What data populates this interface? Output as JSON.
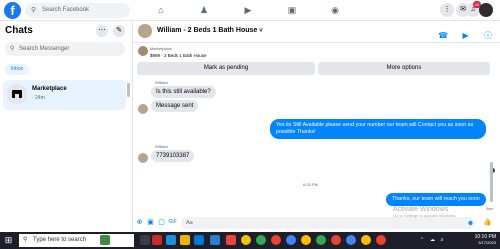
{
  "topbar": {
    "logo": "f",
    "search_placeholder": "Search Facebook",
    "notifications_badge": "20"
  },
  "sidebar": {
    "title": "Chats",
    "search_placeholder": "Search Messenger",
    "inbox_tab": "Inbox",
    "conversation": {
      "name": "Marketplace",
      "time": "· 24m"
    }
  },
  "chat": {
    "title": "William - 2 Beds 1 Bath House",
    "marketplace_label": "Marketplace",
    "listing_price_title": "$999 · 2 Beds 1 Bath House",
    "mark_pending_label": "Mark as pending",
    "more_options_label": "More options",
    "messages": [
      {
        "sender": "William",
        "text": "Is this still available?"
      },
      {
        "text": "Message sent"
      },
      {
        "outgoing": true,
        "text": "Yes its Still Available please send your number our team will Contact you as soon as possible Thanks!"
      },
      {
        "sender": "William",
        "text": "7739103387"
      },
      {
        "timestamp": "6:33 PM"
      },
      {
        "outgoing": true,
        "text": "Thanks, our team will reach you soon",
        "status": "Sent"
      }
    ],
    "composer_placeholder": "Aa"
  },
  "watermark": {
    "line1": "Activate Windows",
    "line2": "Go to Settings to activate Windows."
  },
  "taskbar": {
    "search_placeholder": "Type here to search",
    "time": "10:10 PM",
    "date": "3/17/2023"
  },
  "colors": {
    "brand": "#1877f2",
    "outgoing_bubble": "#0084ff",
    "incoming_bubble": "#e4e6eb"
  },
  "icons": [
    "search-icon",
    "home-icon",
    "friends-icon",
    "watch-icon",
    "marketplace-icon",
    "groups-icon",
    "menu-grid-icon",
    "messenger-icon",
    "bell-icon",
    "phone-icon",
    "video-icon",
    "info-icon",
    "plus-icon",
    "image-icon",
    "sticker-icon",
    "gif-icon",
    "emoji-icon",
    "like-icon"
  ]
}
